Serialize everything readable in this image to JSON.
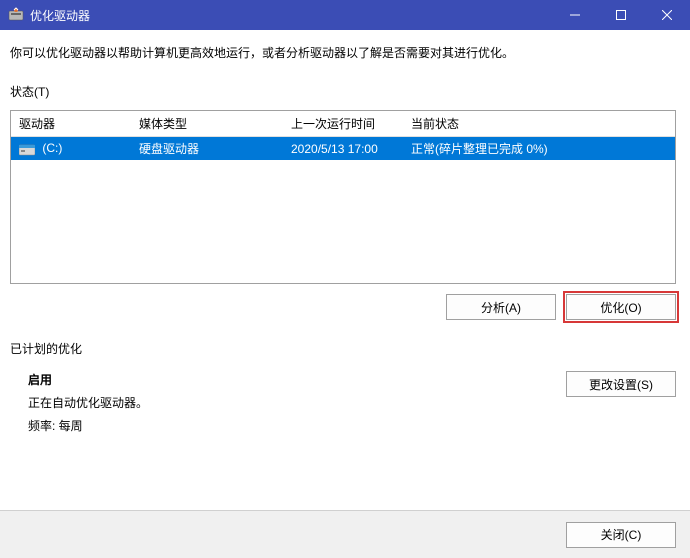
{
  "window": {
    "title": "优化驱动器"
  },
  "description": "你可以优化驱动器以帮助计算机更高效地运行，或者分析驱动器以了解是否需要对其进行优化。",
  "status_label": "状态(T)",
  "table": {
    "headers": {
      "drive": "驱动器",
      "media": "媒体类型",
      "lastrun": "上一次运行时间",
      "status": "当前状态"
    },
    "rows": [
      {
        "drive": "(C:)",
        "media": "硬盘驱动器",
        "lastrun": "2020/5/13 17:00",
        "status": "正常(碎片整理已完成 0%)"
      }
    ]
  },
  "buttons": {
    "analyze": "分析(A)",
    "optimize": "优化(O)",
    "change_settings": "更改设置(S)",
    "close": "关闭(C)"
  },
  "scheduled": {
    "title": "已计划的优化",
    "status": "启用",
    "description": "正在自动优化驱动器。",
    "frequency": "频率: 每周"
  }
}
